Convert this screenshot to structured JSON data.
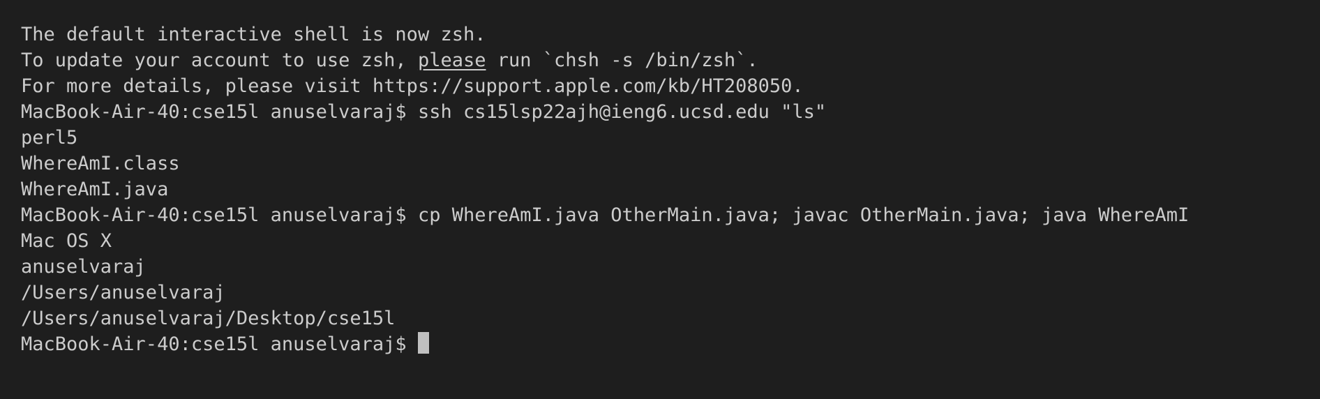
{
  "terminal": {
    "notice_line1": "The default interactive shell is now zsh.",
    "notice_line2_pre": "To update your account to use zsh, ",
    "notice_line2_link": "please",
    "notice_line2_post": " run `chsh -s /bin/zsh`.",
    "notice_line3": "For more details, please visit https://support.apple.com/kb/HT208050.",
    "prompt": "MacBook-Air-40:cse15l anuselvaraj$",
    "command1": " ssh cs15lsp22ajh@ieng6.ucsd.edu \"ls\"",
    "output1": [
      "perl5",
      "WhereAmI.class",
      "WhereAmI.java"
    ],
    "command2": " cp WhereAmI.java OtherMain.java; javac OtherMain.java; java WhereAmI",
    "output2": [
      "Mac OS X",
      "anuselvaraj",
      "/Users/anuselvaraj",
      "/Users/anuselvaraj/Desktop/cse15l"
    ]
  }
}
